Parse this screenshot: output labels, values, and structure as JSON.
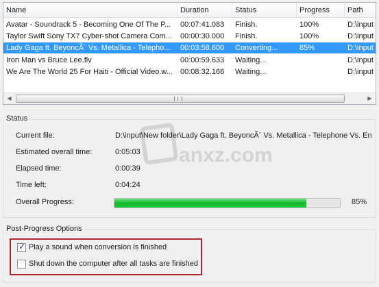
{
  "file_list": {
    "columns": [
      "Name",
      "Duration",
      "Status",
      "Progress",
      "Path"
    ],
    "rows": [
      {
        "name": "Avatar - Soundrack 5 - Becoming One Of The P...",
        "duration": "00:07:41.083",
        "status": "Finish.",
        "progress": "100%",
        "path": "D:\\input"
      },
      {
        "name": "Taylor Swift Sony TX7 Cyber-shot Camera Com...",
        "duration": "00:00:30.000",
        "status": "Finish.",
        "progress": "100%",
        "path": "D:\\input"
      },
      {
        "name": "Lady Gaga ft. BeyoncÃ¨ Vs. Metallica - Telepho...",
        "duration": "00:03:58.600",
        "status": "Converting...",
        "progress": "85%",
        "path": "D:\\input"
      },
      {
        "name": "Iron Man vs Bruce Lee.flv",
        "duration": "00:00:59.633",
        "status": "Waiting...",
        "progress": "",
        "path": "D:\\input"
      },
      {
        "name": "We Are The World 25 For Haiti - Official Video.w...",
        "duration": "00:08:32.166",
        "status": "Waiting...",
        "progress": "",
        "path": "D:\\input"
      }
    ],
    "selected_index": 2
  },
  "status": {
    "title": "Status",
    "current_file_label": "Current file:",
    "current_file_value": "D:\\input\\New folder\\Lady Gaga ft. BeyoncÃ¨ Vs. Metallica - Telephone Vs. En",
    "estimated_label": "Estimated overall time:",
    "estimated_value": "0:05:03",
    "elapsed_label": "Elapsed time:",
    "elapsed_value": "0:00:39",
    "left_label": "Time left:",
    "left_value": "0:04:24",
    "overall_label": "Overall Progress:",
    "overall_percent_text": "85%",
    "overall_fraction": 0.85
  },
  "post": {
    "title": "Post-Progress Options",
    "play_sound_label": "Play a sound when conversion is finished",
    "play_sound_checked": true,
    "shutdown_label": "Shut down the computer after all tasks are finished",
    "shutdown_checked": false
  },
  "watermark": {
    "text": "anxz.com"
  },
  "colors": {
    "selection": "#3399ff",
    "progress_green": "#0fb428",
    "highlight_red": "#b0262f"
  }
}
